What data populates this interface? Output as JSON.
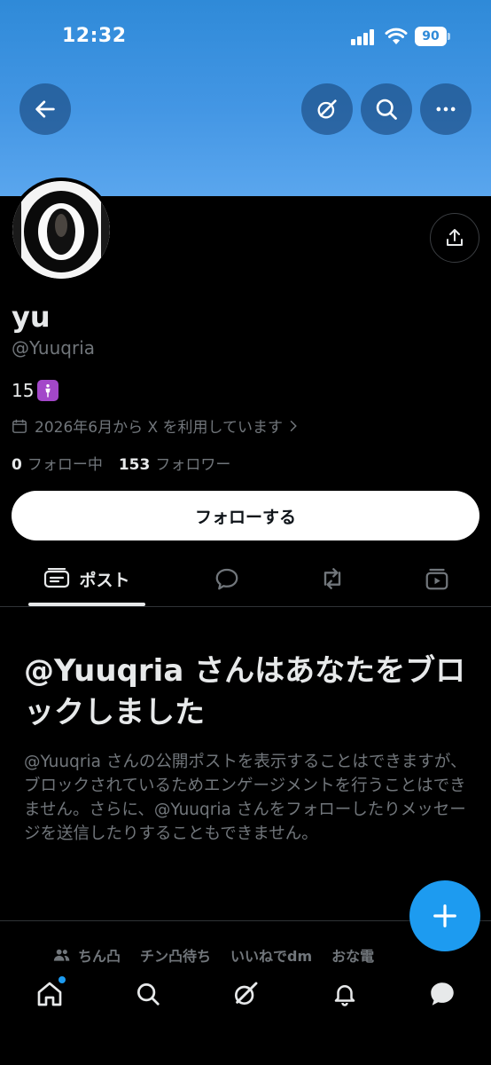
{
  "status_bar": {
    "time": "12:32",
    "battery": "90"
  },
  "header": {
    "back_icon": "arrow-left-icon",
    "grok_icon": "grok-icon",
    "search_icon": "search-icon",
    "more_icon": "more-icon",
    "banner_color": "#4396e4"
  },
  "profile": {
    "name": "yu",
    "handle": "@Yuuqria",
    "bio": "15",
    "bio_emoji": "standing-person-icon",
    "joined": "2026年6月から X を利用しています",
    "following_count": "0",
    "following_label": "フォロー中",
    "followers_count": "153",
    "followers_label": "フォロワー"
  },
  "actions": {
    "follow_label": "フォローする"
  },
  "tabs": [
    {
      "label": "ポスト",
      "icon": "posts-icon",
      "active": true
    },
    {
      "label": "",
      "icon": "reply-icon"
    },
    {
      "label": "",
      "icon": "repost-icon"
    },
    {
      "label": "",
      "icon": "media-icon"
    }
  ],
  "blocked": {
    "title": "@Yuuqria さんはあなたをブロックしました",
    "description": "@Yuuqria さんの公開ポストを表示することはできますが、ブロックされているためエンゲージメントを行うことはできません。さらに、@Yuuqria さんをフォローしたりメッセージを送信したりすることもできません。"
  },
  "communities": [
    "ちん凸",
    "チン凸待ち",
    "いいねでdm",
    "おな電"
  ],
  "bottom_nav": [
    "home-icon",
    "search-icon",
    "grok-icon",
    "notifications-icon",
    "messages-icon"
  ],
  "colors": {
    "accent": "#1d9bf0",
    "muted": "#71767b",
    "text": "#e7e9ea"
  }
}
